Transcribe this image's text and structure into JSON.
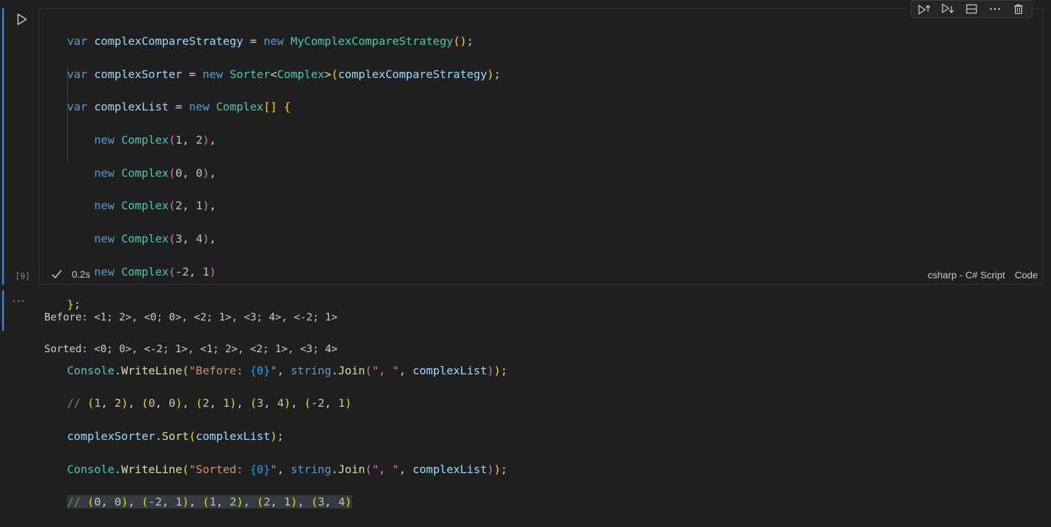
{
  "cell": {
    "execution_count": "[9]",
    "status_time": "0.2s",
    "kernel_label": "csharp - C# Script",
    "language_label": "Code"
  },
  "output": {
    "more_icon": "...",
    "lines": [
      "Before: <1; 2>, <0; 0>, <2; 1>, <3; 4>, <-2; 1>",
      "Sorted: <0; 0>, <-2; 1>, <1; 2>, <2; 1>, <3; 4>"
    ]
  },
  "icons": {
    "run": "play-icon",
    "toolbar": [
      "run-above-icon",
      "run-below-icon",
      "split-cell-icon",
      "more-actions-icon",
      "delete-cell-icon"
    ],
    "status": "check-icon"
  },
  "colors": {
    "focus_indicator": "#2f78d4",
    "success_check": "#89d185",
    "keyword": "#569cd6",
    "type": "#4ec9b0",
    "comment": "#6a9955"
  }
}
